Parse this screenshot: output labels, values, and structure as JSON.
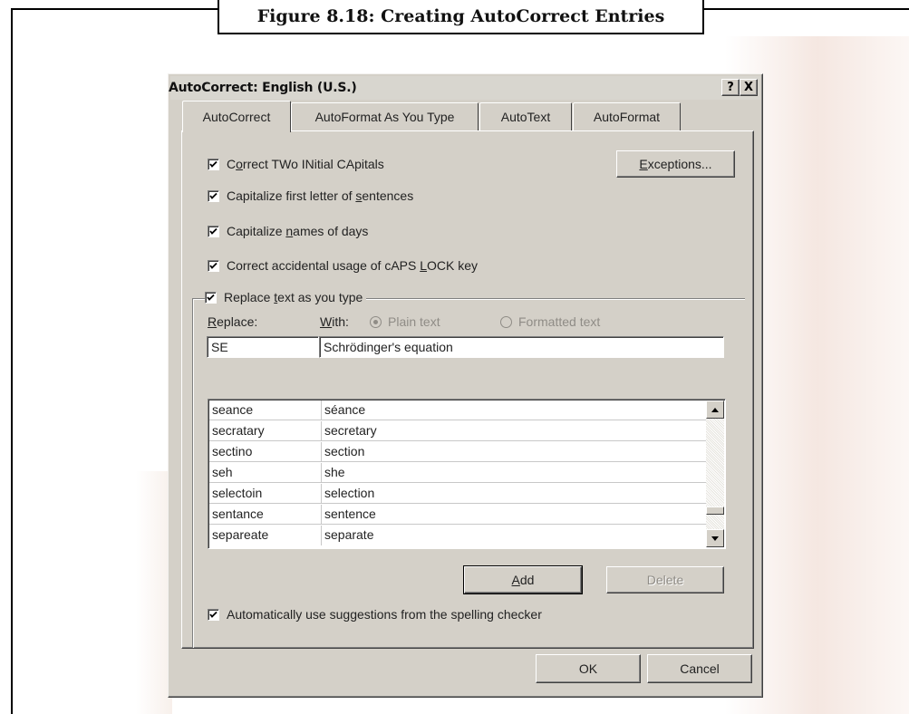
{
  "figure": {
    "caption": "Figure 8.18: Creating AutoCorrect Entries"
  },
  "dialog": {
    "title": "AutoCorrect: English (U.S.)",
    "help_button": "?",
    "close_button": "X",
    "tabs": [
      {
        "label": "AutoCorrect",
        "active": true
      },
      {
        "label": "AutoFormat As You Type",
        "active": false
      },
      {
        "label": "AutoText",
        "active": false
      },
      {
        "label": "AutoFormat",
        "active": false
      }
    ],
    "options": {
      "correct_two_initial": {
        "pre": "C",
        "acc": "o",
        "post": "rrect TWo INitial CApitals",
        "checked": true
      },
      "capitalize_first": {
        "pre": "Capitalize first letter of ",
        "acc": "s",
        "post": "entences",
        "checked": true
      },
      "capitalize_days": {
        "pre": "Capitalize ",
        "acc": "n",
        "post": "ames of days",
        "checked": true
      },
      "caps_lock": {
        "pre": "Correct accidental usage of cAPS ",
        "acc": "L",
        "post": "OCK key",
        "checked": true
      },
      "replace_text": {
        "pre": "Replace ",
        "acc": "t",
        "post": "ext as you type",
        "checked": true
      },
      "suggestions": {
        "pre": "Automatically use su",
        "acc": "g",
        "post": "gestions from the spelling checker",
        "checked": true
      }
    },
    "exceptions_button": {
      "acc": "E",
      "post": "xceptions..."
    },
    "replace_label": {
      "acc": "R",
      "post": "eplace:"
    },
    "with_label": {
      "acc": "W",
      "post": "ith:"
    },
    "radio_plain": {
      "label": "Plain text",
      "selected": true,
      "enabled": false
    },
    "radio_formatted": {
      "label": "Formatted text",
      "selected": false,
      "enabled": false
    },
    "replace_value": "SE",
    "with_value": "Schrödinger's equation",
    "entries": [
      {
        "from": "seance",
        "to": "séance"
      },
      {
        "from": "secratary",
        "to": "secretary"
      },
      {
        "from": "sectino",
        "to": "section"
      },
      {
        "from": "seh",
        "to": "she"
      },
      {
        "from": "selectoin",
        "to": "selection"
      },
      {
        "from": "sentance",
        "to": "sentence"
      },
      {
        "from": "separeate",
        "to": "separate"
      }
    ],
    "add_button": {
      "acc": "A",
      "post": "dd"
    },
    "delete_button": "Delete",
    "ok_button": "OK",
    "cancel_button": "Cancel"
  }
}
